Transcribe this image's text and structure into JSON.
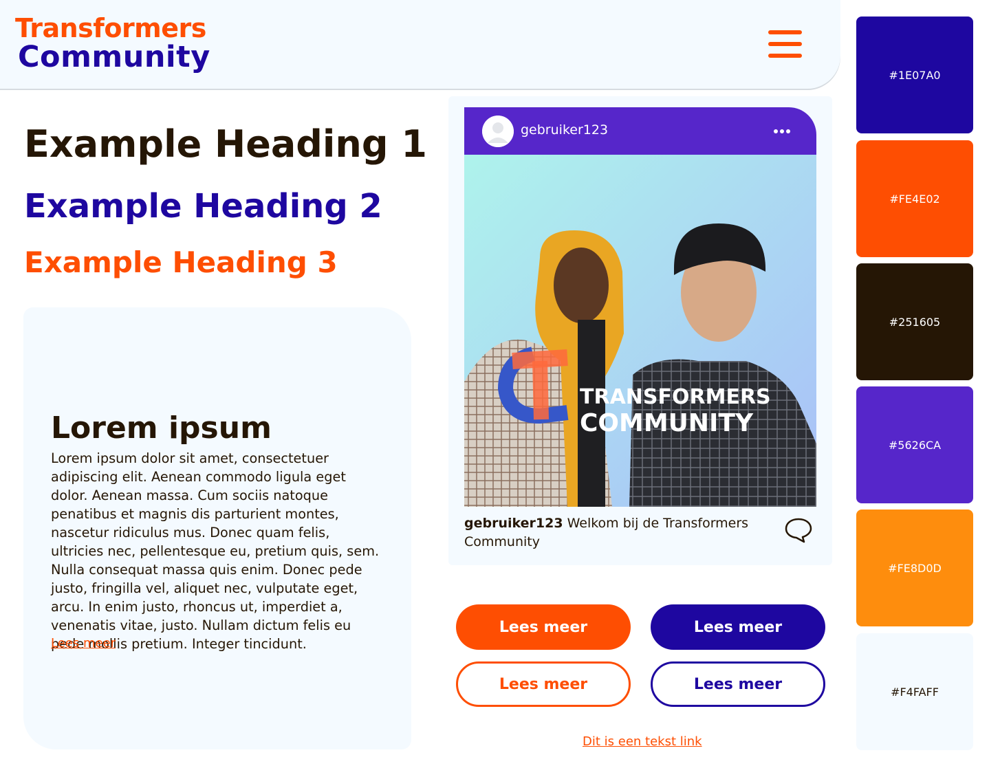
{
  "header": {
    "logo_line1": "Transformers",
    "logo_line2": "Community",
    "menu_icon": "hamburger-icon"
  },
  "headings": {
    "h1": "Example Heading 1",
    "h2": "Example Heading 2",
    "h3": "Example Heading 3"
  },
  "card": {
    "title": "Lorem ipsum",
    "body": "Lorem ipsum dolor sit amet, consectetuer adipiscing elit. Aenean commodo ligula eget dolor. Aenean massa. Cum sociis natoque penatibus et magnis dis parturient montes, nascetur ridiculus mus. Donec quam felis, ultricies nec, pellentesque eu, pretium quis, sem. Nulla consequat massa quis enim. Donec pede justo, fringilla vel, aliquet nec, vulputate eget, arcu. In enim justo, rhoncus ut, imperdiet a, venenatis vitae, justo. Nullam dictum felis eu pede mollis pretium. Integer tincidunt.",
    "link": "Lees meer"
  },
  "post": {
    "username": "gebruiker123",
    "image_logo_line1": "TRANSFORMERS",
    "image_logo_line2": "COMMUNITY",
    "caption_user": "gebruiker123",
    "caption_text": " Welkom bij de Transformers Community",
    "icons": [
      "avatar-icon",
      "more-icon",
      "comment-icon"
    ]
  },
  "buttons": {
    "solid_orange": "Lees meer",
    "solid_blue": "Lees meer",
    "outline_orange": "Lees meer",
    "outline_blue": "Lees meer"
  },
  "text_link": "Dit is een tekst link",
  "palette": [
    {
      "hex": "#1E07A0",
      "label": "#1E07A0",
      "text_color": "#ffffff"
    },
    {
      "hex": "#FE4E02",
      "label": "#FE4E02",
      "text_color": "#ffffff"
    },
    {
      "hex": "#251605",
      "label": "#251605",
      "text_color": "#ffffff"
    },
    {
      "hex": "#5626CA",
      "label": "#5626CA",
      "text_color": "#ffffff"
    },
    {
      "hex": "#FE8D0D",
      "label": "#FE8D0D",
      "text_color": "#ffffff"
    },
    {
      "hex": "#F4FAFF",
      "label": "#F4FAFF",
      "text_color": "#251605"
    }
  ]
}
